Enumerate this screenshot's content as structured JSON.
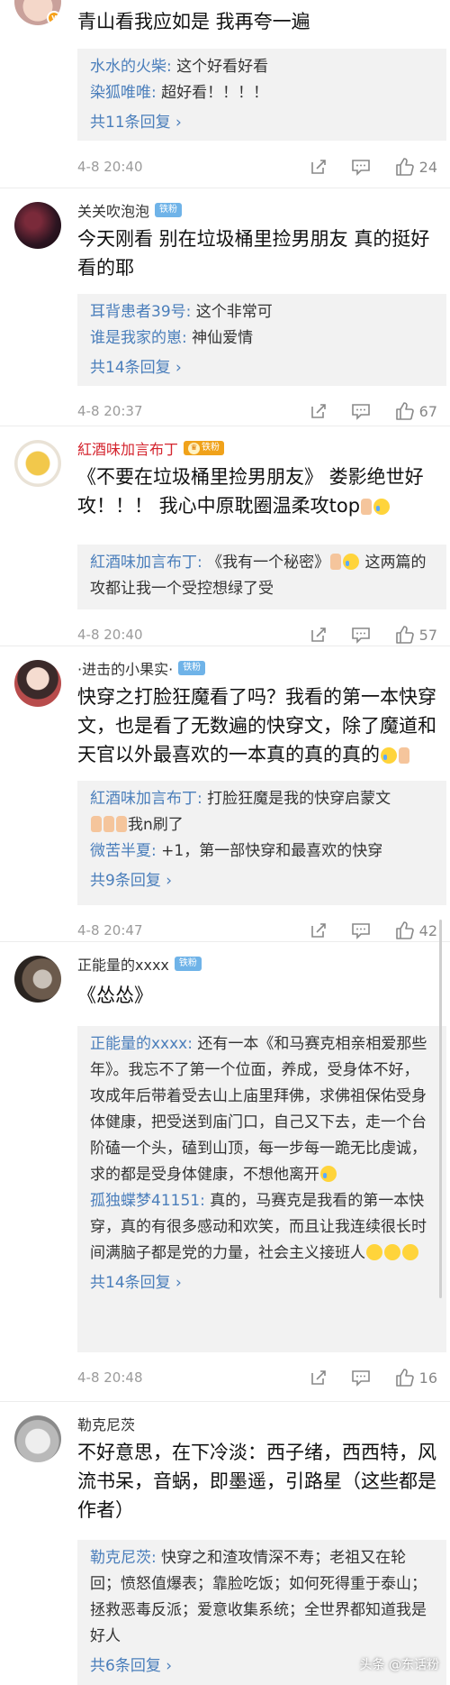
{
  "comments": [
    {
      "username": "",
      "text": "青山看我应如是 我再夸一遍",
      "replies": [
        {
          "name": "水水的火柴",
          "text": "这个好看好看"
        },
        {
          "name": "染狐唯唯",
          "text": "超好看！！！！"
        }
      ],
      "total": "共11条回复",
      "time": "4-8 20:40",
      "likes": "24"
    },
    {
      "username": "关关吹泡泡",
      "badge": "铁粉",
      "text": "今天刚看 别在垃圾桶里捡男朋友 真的挺好看的耶",
      "replies": [
        {
          "name": "耳背患者39号",
          "text": "这个非常可"
        },
        {
          "name": "谁是我家的崽",
          "text": "神仙爱情"
        }
      ],
      "total": "共14条回复",
      "time": "4-8 20:37",
      "likes": "67"
    },
    {
      "username": "紅酒味加言布丁",
      "badge": "铁粉",
      "text_a": "《不要在垃圾桶里捡男朋友》 娄影绝世好攻！！！ 我心中原耽圈温柔攻top",
      "reply_name": "紅酒味加言布丁",
      "reply_a": "《我有一个秘密》",
      "reply_b": " 这两篇的攻都让我一个受控想绿了受",
      "time": "4-8 20:40",
      "likes": "57"
    },
    {
      "username": "·进击的小果实·",
      "badge": "铁粉",
      "text": "快穿之打脸狂魔看了吗？我看的第一本快穿文，也是看了无数遍的快穿文，除了魔道和天官以外最喜欢的一本真的真的真的",
      "reply1_name": "紅酒味加言布丁",
      "reply1_text": "打脸狂魔是我的快穿启蒙文",
      "reply1_tail": "我n刷了",
      "reply2_name": "微苦半夏",
      "reply2_text": "+1，第一部快穿和最喜欢的快穿",
      "total": "共9条回复",
      "time": "4-8 20:47",
      "likes": "42"
    },
    {
      "username": "正能量的xxxx",
      "badge": "铁粉",
      "text": "《怂怂》",
      "reply1_name": "正能量的xxxx",
      "reply1_text": "还有一本《和马赛克相亲相爱那些年》。我忘不了第一个位面，养成，受身体不好，攻成年后带着受去山上庙里拜佛，求佛祖保佑受身体健康，把受送到庙门口，自己又下去，走一个台阶磕一个头，磕到山顶，每一步每一跪无比虔诚，求的都是受身体健康，不想他离开",
      "reply2_name": "孤独蝶梦41151",
      "reply2_text": "真的，马赛克是我看的第一本快穿，真的有很多感动和欢笑，而且让我连续很长时间满脑子都是党的力量，社会主义接班人",
      "total": "共14条回复",
      "time": "4-8 20:48",
      "likes": "16"
    },
    {
      "username": "勒克尼茨",
      "text": "不好意思，在下冷淡：西子绪，西西特，风流书呆，音蜗，即墨遥，引路星（这些都是作者）",
      "reply_name": "勒克尼茨",
      "reply_text": "快穿之和渣攻情深不寿；老祖又在轮回；愤怒值爆表；靠脸吃饭；如何死得重于泰山；拯救恶毒反派；爱意收集系统；全世界都知道我是好人",
      "total": "共6条回复"
    }
  ],
  "reply_sep": ": ",
  "watermark": "头条 @东话粉",
  "icons": [
    "share-icon",
    "comment-icon",
    "like-icon"
  ],
  "colors": {
    "link": "#4a7ebb",
    "name_red": "#d4242e",
    "badge_blue": "#6fb3e8",
    "reply_bg": "#f2f2f2"
  }
}
